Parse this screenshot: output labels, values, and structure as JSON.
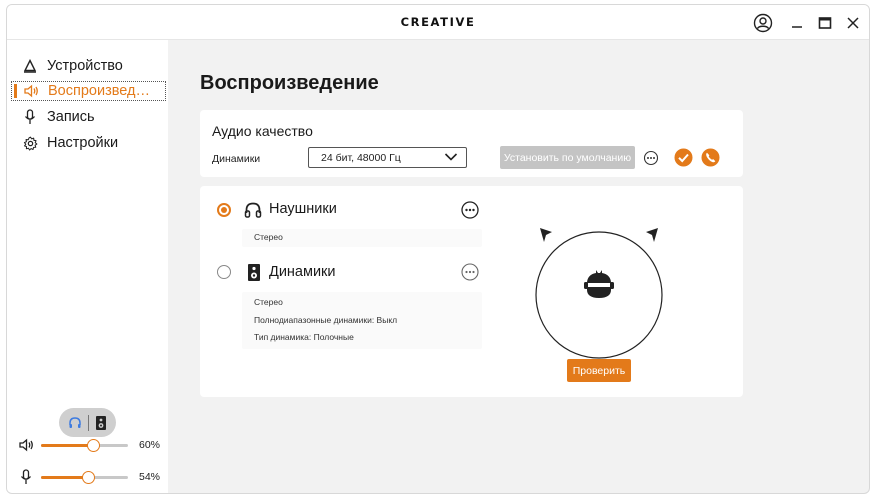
{
  "titlebar": {
    "brand": "CREATIVE",
    "icons": [
      "account-icon",
      "minimize-icon",
      "maximize-icon",
      "close-icon"
    ]
  },
  "sidebar": {
    "items": [
      {
        "label": "Устройство",
        "icon": "device-icon",
        "active": false
      },
      {
        "label": "Воспроизвед…",
        "icon": "speaker-volume-icon",
        "active": true
      },
      {
        "label": "Запись",
        "icon": "microphone-icon",
        "active": false
      },
      {
        "label": "Настройки",
        "icon": "gear-icon",
        "active": false
      }
    ],
    "output_toggle": {
      "icons": [
        "headphones-icon",
        "speaker-icon"
      ],
      "selected": "headphones-icon"
    },
    "volume": {
      "icon": "speaker-volume-icon",
      "value": 60,
      "label": "60%"
    },
    "mic": {
      "icon": "microphone-icon",
      "value": 54,
      "label": "54%"
    }
  },
  "main": {
    "title": "Воспроизведение",
    "audio_quality": {
      "title": "Аудио качество",
      "device_label": "Динамики",
      "format_selected": "24 бит, 48000 Гц",
      "set_default_label": "Установить по умолчанию",
      "set_default_enabled": false
    },
    "devices": [
      {
        "name": "Наушники",
        "icon": "headphones-icon",
        "selected": true,
        "info": [
          "Стерео"
        ]
      },
      {
        "name": "Динамики",
        "icon": "speaker-icon",
        "selected": false,
        "info": [
          "Стерео",
          "Полнодиапазонные динамики: Выкл",
          "Тип динамика: Полочные"
        ]
      }
    ],
    "test_button": "Проверить"
  },
  "colors": {
    "accent": "#e37a1a",
    "disabled": "#c4c4c4",
    "panel": "#f2f2f2"
  }
}
